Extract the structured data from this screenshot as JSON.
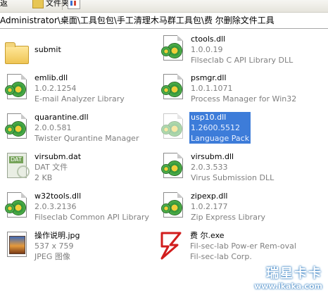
{
  "toolbar": {
    "back": "返",
    "folders": "文件夹"
  },
  "address": {
    "path": "Administrator\\桌面\\工具包包\\手工清理木马群工具包\\费 尔删除文件工具"
  },
  "files": [
    {
      "name": "submit",
      "type": "",
      "desc": "",
      "icon": "folder-icon"
    },
    {
      "name": "ctools.dll",
      "type": "1.0.0.19",
      "desc": "Filseclab C API Library DLL",
      "icon": "dll-icon"
    },
    {
      "name": "emlib.dll",
      "type": "1.0.2.1254",
      "desc": "E-mail Analyzer Library",
      "icon": "dll-icon"
    },
    {
      "name": "psmgr.dll",
      "type": "1.0.1.1071",
      "desc": "Process Manager for Win32",
      "icon": "dll-icon"
    },
    {
      "name": "quarantine.dll",
      "type": "2.0.0.581",
      "desc": "Twister Qurantine Manager",
      "icon": "dll-icon"
    },
    {
      "name": "usp10.dll",
      "type": "1.2600.5512",
      "desc": "Language Pack",
      "icon": "dll-icon",
      "selected": true
    },
    {
      "name": "virsubm.dat",
      "type": "DAT 文件",
      "desc": "2 KB",
      "icon": "dat-icon"
    },
    {
      "name": "virsubm.dll",
      "type": "2.0.3.533",
      "desc": "Virus Submission DLL",
      "icon": "dll-icon"
    },
    {
      "name": "w32tools.dll",
      "type": "2.0.3.2136",
      "desc": "Filseclab Common API Library",
      "icon": "dll-icon"
    },
    {
      "name": "zipexp.dll",
      "type": "1.0.2.177",
      "desc": "Zip Express Library",
      "icon": "dll-icon"
    },
    {
      "name": "操作说明.jpg",
      "type": "537 x 759",
      "desc": "JPEG 图像",
      "icon": "jpg-icon"
    },
    {
      "name": "费 尔.exe",
      "type": "Fil-sec-lab Pow-er Rem-oval",
      "desc": "Fil-sec-lab Corp.",
      "icon": "exe-icon"
    }
  ],
  "watermark": {
    "title": "瑞星卡卡",
    "url": "www.ikaka.com"
  }
}
